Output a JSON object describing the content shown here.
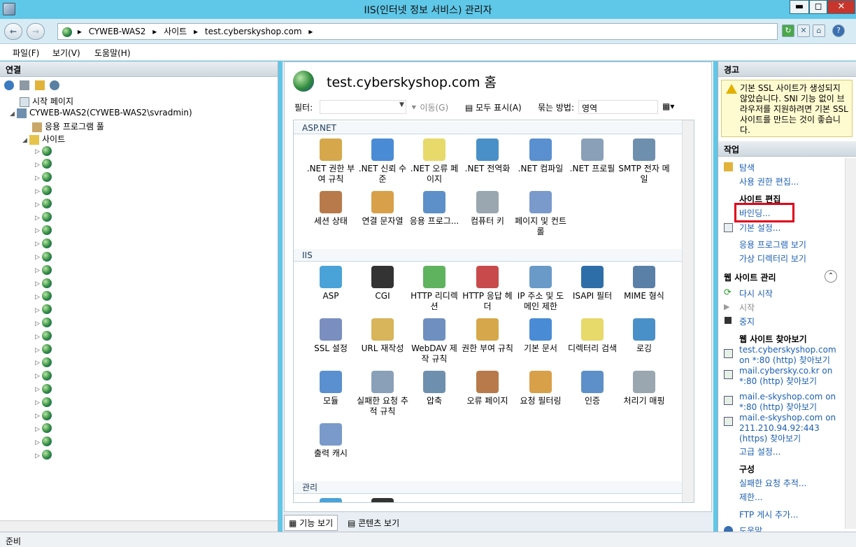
{
  "window": {
    "title": "IIS(인터넷 정보 서비스) 관리자",
    "minimize": "▬",
    "maximize": "◻",
    "close": "✕"
  },
  "address": {
    "segments": [
      "CYWEB-WAS2",
      "사이트",
      "test.cyberskyshop.com"
    ],
    "sep": "▸"
  },
  "menu": [
    "파일(F)",
    "보기(V)",
    "도움말(H)"
  ],
  "left": {
    "header": "연결",
    "tree": {
      "start": "시작 페이지",
      "server": "CYWEB-WAS2(CYWEB-WAS2\\svradmin)",
      "apppool": "응용 프로그램 풀",
      "sites": "사이트"
    },
    "site_rows": 24
  },
  "center": {
    "title": "test.cyberskyshop.com 홈",
    "filter_label": "필터:",
    "go_label": "이동(G)",
    "showall_label": "모두 표시(A)",
    "groupby_label": "묶는 방법:",
    "groupby_value": "영역",
    "sections": [
      {
        "name": "ASP.NET",
        "items": [
          ".NET 권한 부여 규칙",
          ".NET 신뢰 수준",
          ".NET 오류 페이지",
          ".NET 전역화",
          ".NET 컴파일",
          ".NET 프로필",
          "SMTP 전자 메일",
          "세션 상태",
          "연결 문자열",
          "응용 프로그...",
          "컴퓨터 키",
          "페이지 및 컨트롤"
        ]
      },
      {
        "name": "IIS",
        "items": [
          "ASP",
          "CGI",
          "HTTP 리디렉션",
          "HTTP 응답 헤더",
          "IP 주소 및 도메인 제한",
          "ISAPI 필터",
          "MIME 형식",
          "SSL 설정",
          "URL 재작성",
          "WebDAV 제작 규칙",
          "권한 부여 규칙",
          "기본 문서",
          "디렉터리 검색",
          "로깅",
          "모듈",
          "실패한 요청 추적 규칙",
          "압축",
          "오류 페이지",
          "요청 필터링",
          "인증",
          "처리기 매핑",
          "출력 캐시"
        ]
      },
      {
        "name": "관리",
        "items": [
          "",
          ""
        ]
      }
    ],
    "view_tabs": [
      "기능 보기",
      "콘텐츠 보기"
    ]
  },
  "right": {
    "warning_header": "경고",
    "warning": "기본 SSL 사이트가 생성되지 않았습니다. SNI 기능 없이 브라우저를 지원하려면 기본 SSL 사이트를 만드는 것이 좋습니다.",
    "actions_header": "작업",
    "explore": "탐색",
    "edit_perm": "사용 권한 편집...",
    "edit_site": "사이트 편집",
    "bindings": "바인딩...",
    "basic": "기본 설정...",
    "view_apps": "응용 프로그램 보기",
    "view_vdirs": "가상 디렉터리 보기",
    "manage_header": "웹 사이트 관리",
    "restart": "다시 시작",
    "start": "시작",
    "stop": "중지",
    "browse_header": "웹 사이트 찾아보기",
    "browse": [
      "test.cyberskyshop.com on *:80 (http) 찾아보기",
      "mail.cybersky.co.kr on *:80 (http) 찾아보기",
      "mail.e-skyshop.com on *:80 (http) 찾아보기",
      "mail.e-skyshop.com on 211.210.94.92:443 (https) 찾아보기"
    ],
    "advanced": "고급 설정...",
    "config_header": "구성",
    "failed": "실패한 요청 추적...",
    "limits": "제한...",
    "ftp": "FTP 게시 추가...",
    "help": "도움말"
  },
  "status": "준비"
}
